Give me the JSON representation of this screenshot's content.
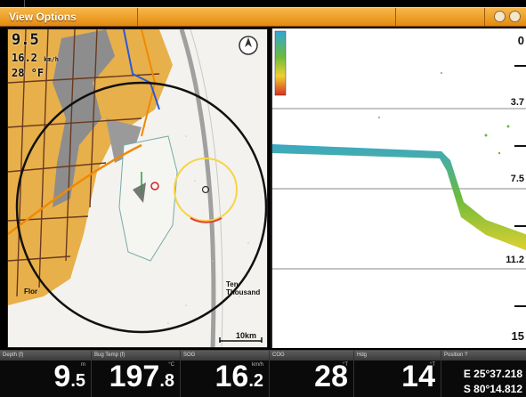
{
  "topbar": {
    "title": "View Options"
  },
  "map": {
    "depth": "9.5",
    "speed_value": "16.2",
    "speed_unit": "km/h",
    "temp": "28 °F",
    "scale": "10km",
    "place_florida": "Flor",
    "place_ten_thousand": "Ten Thousand"
  },
  "sonar": {
    "depth_labels": [
      "0",
      "3.7",
      "7.5",
      "11.2",
      "15"
    ]
  },
  "databar": {
    "cells": [
      {
        "header": "Depth (f)",
        "unit": "m",
        "value_main": "9",
        "value_small": ".5"
      },
      {
        "header": "Bug Temp (f)",
        "unit": "°C",
        "value_main": "197",
        "value_small": ".8"
      },
      {
        "header": "SOG",
        "unit": "km/h",
        "value_main": "16",
        "value_small": ".2"
      },
      {
        "header": "COG",
        "unit": "°T",
        "value_main": "28",
        "value_small": ""
      },
      {
        "header": "Hdg",
        "unit": "°T",
        "value_main": "14",
        "value_small": ""
      },
      {
        "header": "Position ?",
        "lat": "E 25°37.218",
        "lon": "S 80°14.812"
      }
    ]
  },
  "colors": {
    "menu": "#e9951f",
    "water_line": "#6cbb3c",
    "range_ring": "#f5d547"
  }
}
